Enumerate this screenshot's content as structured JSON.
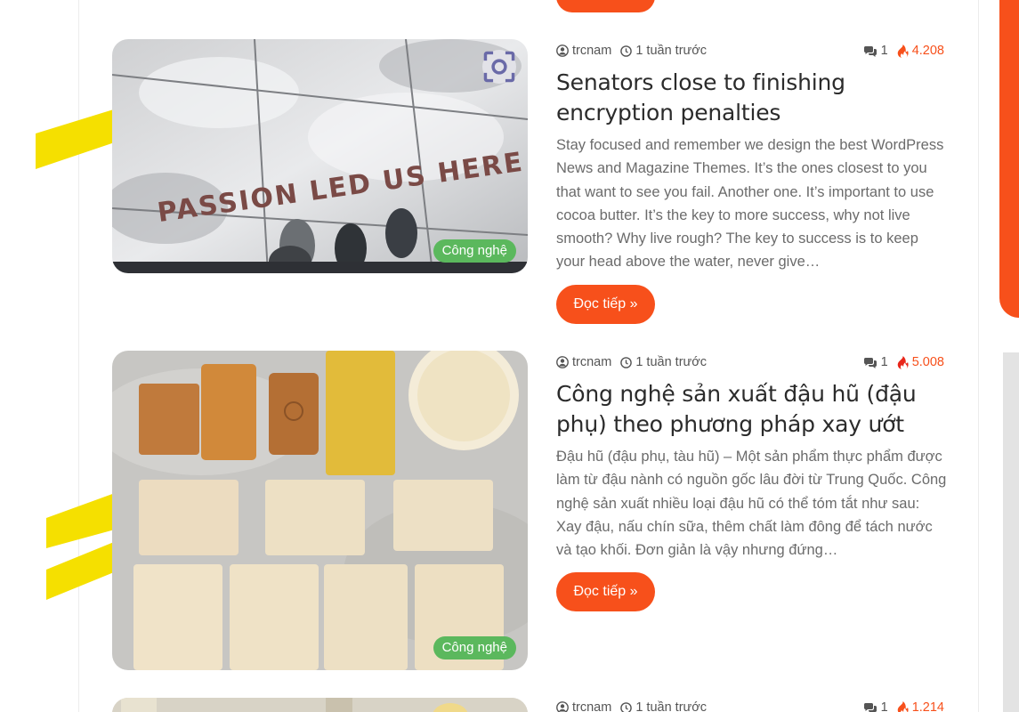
{
  "posts": [
    {
      "author": "trcnam",
      "time": "1 tuần trước",
      "comments": "1",
      "views": "4.208",
      "title": "Senators close to finishing encryption penalties",
      "excerpt": "Stay focused and remember we design the best WordPress News and Magazine Themes. It’s the ones closest to you that want to see you fail. Another one. It’s important to use cocoa butter. It’s the key to more success, why not live smooth? Why live rough? The key to success is to keep your head above the water, never give…",
      "category": "Công nghệ",
      "read_more": "Đọc tiếp »",
      "image_text": "PASSION LED US HERE"
    },
    {
      "author": "trcnam",
      "time": "1 tuần trước",
      "comments": "1",
      "views": "5.008",
      "title": "Công nghệ sản xuất đậu hũ (đậu phụ) theo phương pháp xay ướt",
      "excerpt": "Đậu hũ (đậu phụ, tàu hũ) – Một sản phẩm thực phẩm được làm từ đậu nành có nguồn gốc lâu đời từ Trung Quốc. Công nghệ sản xuất nhiều loại đậu hũ có thể tóm tắt như sau: Xay đậu, nấu chín sữa, thêm chất làm đông để tách nước và tạo khối. Đơn giản là vậy nhưng đứng…",
      "category": "Công nghệ",
      "read_more": "Đọc tiếp »"
    },
    {
      "author": "trcnam",
      "time": "1 tuần trước",
      "comments": "1",
      "views": "1.214"
    }
  ],
  "colors": {
    "accent": "#f7501b",
    "category": "#5bb85d",
    "highlight": "#f5e000"
  },
  "icons": [
    "user-icon",
    "clock-icon",
    "comments-icon",
    "fire-icon",
    "zoom-lens-icon"
  ]
}
